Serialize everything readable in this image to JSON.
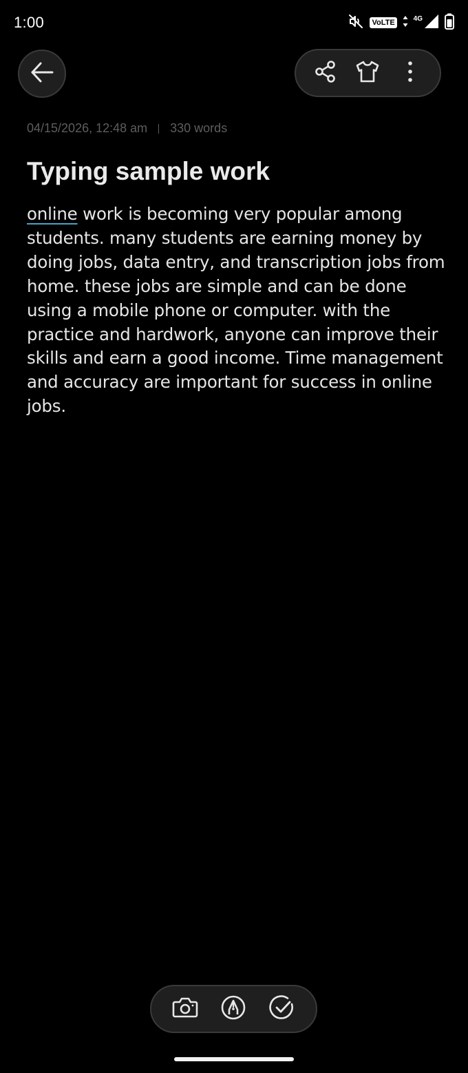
{
  "status_bar": {
    "time": "1:00",
    "volte_label": "VoLTE",
    "network_label": "4G",
    "icons": [
      "mute-icon",
      "volte-icon",
      "data-arrows-icon",
      "signal-icon",
      "battery-icon"
    ]
  },
  "toolbar": {
    "back_icon": "arrow-left-icon",
    "actions": [
      "share-icon",
      "theme-shirt-icon",
      "more-vertical-icon"
    ]
  },
  "note": {
    "date": "04/15/2026, 12:48 am",
    "word_count": "330 words",
    "title": "Typing sample work",
    "body_first_word": "online",
    "body_rest": " work is becoming very popular among students. many students are earning money by doing jobs, data entry, and transcription jobs from home. these jobs are simple and can be done using a mobile phone or computer. with the practice and hardwork, anyone can improve their skills and earn a good income. Time management and accuracy are important for success in online jobs."
  },
  "bottom_tools": [
    "camera-icon",
    "pen-icon",
    "checklist-icon"
  ],
  "colors": {
    "background": "#000000",
    "pill_bg": "#1f1f1f",
    "pill_border": "#3a3a3a",
    "meta_text": "#5d5d5d",
    "spell_underline": "#4aa3c7"
  }
}
